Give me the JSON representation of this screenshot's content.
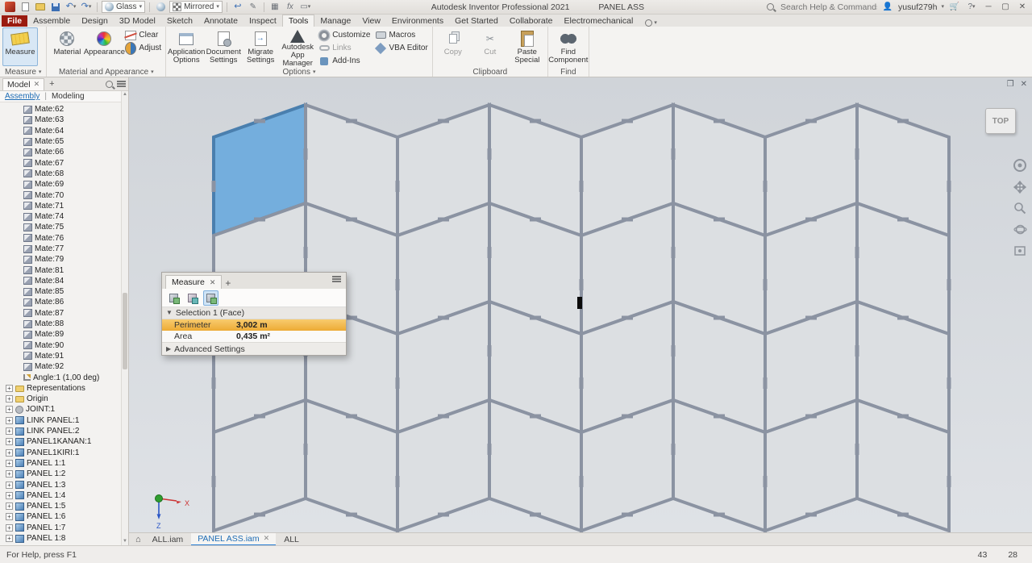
{
  "colors": {
    "selection_blue": "#74aedd",
    "selection_stroke": "#4a7fae",
    "highlight_orange": "#f2b64e",
    "panel_gray": "#dcdfe2",
    "gap_gray": "#8b93a2"
  },
  "titlebar": {
    "app_title": "Autodesk Inventor Professional 2021",
    "doc_title": "PANEL ASS",
    "material_value": "Glass",
    "appearance_value": "Mirrored",
    "search_placeholder": "Search Help & Commands...",
    "user_name": "yusuf279h"
  },
  "ribbon": {
    "tabs": [
      "File",
      "Assemble",
      "Design",
      "3D Model",
      "Sketch",
      "Annotate",
      "Inspect",
      "Tools",
      "Manage",
      "View",
      "Environments",
      "Get Started",
      "Collaborate",
      "Electromechanical"
    ],
    "active_tab": "Tools",
    "groups": [
      {
        "label": "Measure"
      },
      {
        "label": "Material and Appearance"
      },
      {
        "label": "Options"
      },
      {
        "label": "Clipboard"
      },
      {
        "label": "Find"
      }
    ],
    "buttons": {
      "measure": "Measure",
      "material": "Material",
      "appearance": "Appearance",
      "adjust": "Adjust",
      "clear": "Clear",
      "application_options": "Application Options",
      "document_settings": "Document Settings",
      "migrate_settings": "Migrate Settings",
      "autodesk_app_manager": "Autodesk App Manager",
      "customize": "Customize",
      "links": "Links",
      "addins": "Add-Ins",
      "macros": "Macros",
      "vba_editor": "VBA Editor",
      "copy": "Copy",
      "cut": "Cut",
      "paste_special": "Paste Special",
      "find_component": "Find Component"
    }
  },
  "browser": {
    "panel_tab": "Model",
    "mode_tabs": [
      "Assembly",
      "Modeling"
    ],
    "active_mode": "Assembly",
    "tree": [
      {
        "label": "Mate:62",
        "icon": "mate"
      },
      {
        "label": "Mate:63",
        "icon": "mate"
      },
      {
        "label": "Mate:64",
        "icon": "mate"
      },
      {
        "label": "Mate:65",
        "icon": "mate"
      },
      {
        "label": "Mate:66",
        "icon": "mate"
      },
      {
        "label": "Mate:67",
        "icon": "mate"
      },
      {
        "label": "Mate:68",
        "icon": "mate"
      },
      {
        "label": "Mate:69",
        "icon": "mate"
      },
      {
        "label": "Mate:70",
        "icon": "mate"
      },
      {
        "label": "Mate:71",
        "icon": "mate"
      },
      {
        "label": "Mate:74",
        "icon": "mate"
      },
      {
        "label": "Mate:75",
        "icon": "mate"
      },
      {
        "label": "Mate:76",
        "icon": "mate"
      },
      {
        "label": "Mate:77",
        "icon": "mate"
      },
      {
        "label": "Mate:79",
        "icon": "mate"
      },
      {
        "label": "Mate:81",
        "icon": "mate"
      },
      {
        "label": "Mate:84",
        "icon": "mate"
      },
      {
        "label": "Mate:85",
        "icon": "mate"
      },
      {
        "label": "Mate:86",
        "icon": "mate"
      },
      {
        "label": "Mate:87",
        "icon": "mate"
      },
      {
        "label": "Mate:88",
        "icon": "mate"
      },
      {
        "label": "Mate:89",
        "icon": "mate"
      },
      {
        "label": "Mate:90",
        "icon": "mate"
      },
      {
        "label": "Mate:91",
        "icon": "mate"
      },
      {
        "label": "Mate:92",
        "icon": "mate"
      },
      {
        "label": "Angle:1 (1,00 deg)",
        "icon": "angle"
      },
      {
        "label": "Representations",
        "icon": "representations",
        "expand": true
      },
      {
        "label": "Origin",
        "icon": "folder",
        "expand": true
      },
      {
        "label": "JOINT:1",
        "icon": "joint",
        "expand": true
      },
      {
        "label": "LINK PANEL:1",
        "icon": "component",
        "expand": true
      },
      {
        "label": "LINK PANEL:2",
        "icon": "component",
        "expand": true
      },
      {
        "label": "PANEL1KANAN:1",
        "icon": "component",
        "expand": true
      },
      {
        "label": "PANEL1KIRI:1",
        "icon": "component",
        "expand": true
      },
      {
        "label": "PANEL 1:1",
        "icon": "component",
        "expand": true
      },
      {
        "label": "PANEL 1:2",
        "icon": "component",
        "expand": true
      },
      {
        "label": "PANEL 1:3",
        "icon": "component",
        "expand": true
      },
      {
        "label": "PANEL 1:4",
        "icon": "component",
        "expand": true
      },
      {
        "label": "PANEL 1:5",
        "icon": "component",
        "expand": true
      },
      {
        "label": "PANEL 1:6",
        "icon": "component",
        "expand": true
      },
      {
        "label": "PANEL 1:7",
        "icon": "component",
        "expand": true
      },
      {
        "label": "PANEL 1:8",
        "icon": "component",
        "expand": true
      }
    ]
  },
  "measure_dialog": {
    "tab_title": "Measure",
    "selection_header": "Selection 1 (Face)",
    "rows": [
      {
        "label": "Perimeter",
        "value": "3,002 m",
        "highlight": true
      },
      {
        "label": "Area",
        "value": "0,435 m²",
        "highlight": false
      }
    ],
    "advanced_label": "Advanced Settings"
  },
  "viewport": {
    "viewcube_label": "TOP",
    "axis_labels": {
      "x": "X",
      "z": "Z"
    }
  },
  "doc_tabs": {
    "items": [
      {
        "label": "ALL.iam",
        "active": false,
        "closable": false
      },
      {
        "label": "PANEL ASS.iam",
        "active": true,
        "closable": true
      },
      {
        "label": "ALL",
        "active": false,
        "closable": false
      }
    ]
  },
  "statusbar": {
    "help_text": "For Help, press F1",
    "value_a": "43",
    "value_b": "28"
  }
}
